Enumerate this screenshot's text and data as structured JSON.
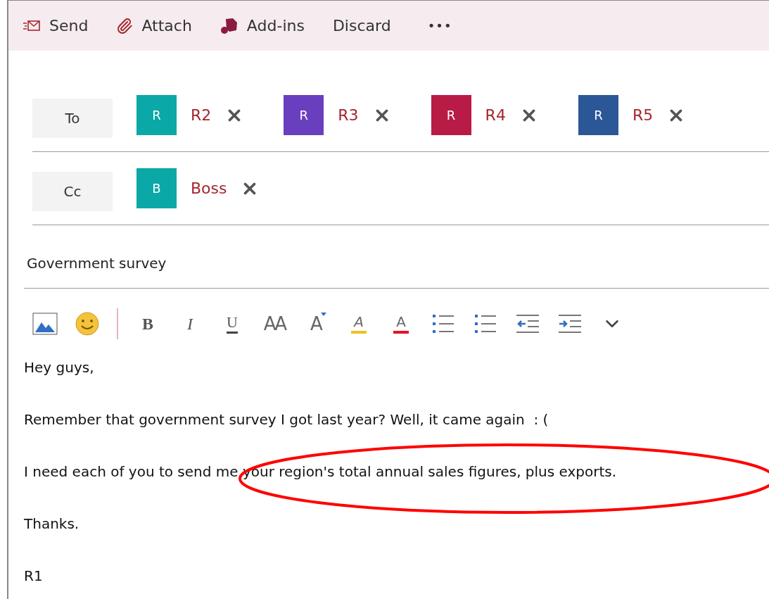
{
  "command_bar": [
    {
      "kind": "send",
      "label": "Send"
    },
    {
      "kind": "attach",
      "label": "Attach"
    },
    {
      "kind": "addins",
      "label": "Add-ins"
    },
    {
      "kind": "plain",
      "label": "Discard"
    },
    {
      "kind": "more",
      "label": "•••"
    }
  ],
  "to": {
    "label": "To",
    "recipients": [
      {
        "initial": "R",
        "name": "R2",
        "color": "#0aa8a7"
      },
      {
        "initial": "R",
        "name": "R3",
        "color": "#6a3fbf"
      },
      {
        "initial": "R",
        "name": "R4",
        "color": "#b81b45"
      },
      {
        "initial": "R",
        "name": "R5",
        "color": "#2b5797"
      }
    ]
  },
  "cc": {
    "label": "Cc",
    "recipients": [
      {
        "initial": "B",
        "name": "Boss",
        "color": "#0aa8a7"
      }
    ]
  },
  "subject": "Government survey",
  "format_tools": [
    {
      "kind": "picture"
    },
    {
      "kind": "emoji"
    },
    {
      "kind": "separator"
    },
    {
      "kind": "bold",
      "glyph": "B"
    },
    {
      "kind": "italic",
      "glyph": "I"
    },
    {
      "kind": "underline",
      "glyph": "U"
    },
    {
      "kind": "size",
      "glyph": "AA"
    },
    {
      "kind": "grow",
      "glyph": "A"
    },
    {
      "kind": "highlight",
      "glyph": "A"
    },
    {
      "kind": "color",
      "glyph": "A"
    },
    {
      "kind": "bullets"
    },
    {
      "kind": "numbering"
    },
    {
      "kind": "outdent"
    },
    {
      "kind": "indent"
    },
    {
      "kind": "more"
    }
  ],
  "body": [
    "Hey guys,",
    "Remember that government survey I got last year? Well, it came again  : (",
    "I need each of you to send me your region's total annual sales figures, plus exports.",
    "Thanks.",
    "R1"
  ],
  "annotation": {
    "kind": "ellipse"
  }
}
